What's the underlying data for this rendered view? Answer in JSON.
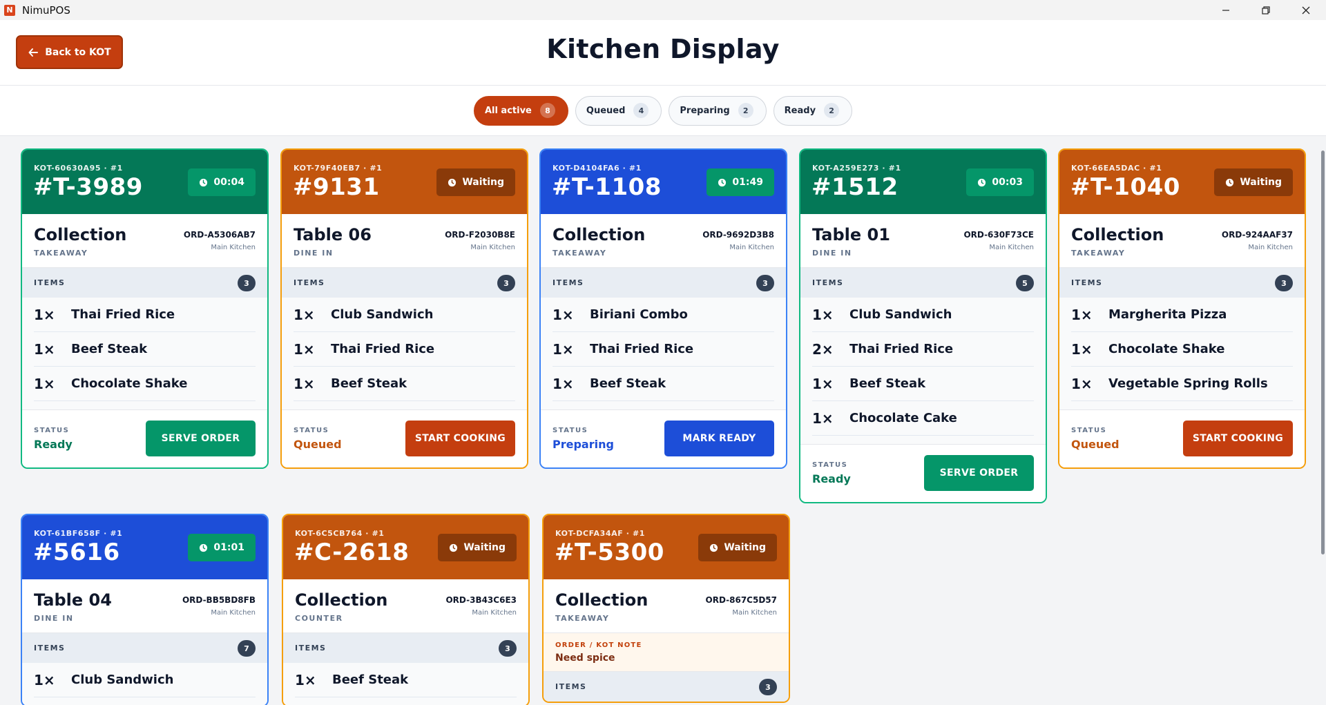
{
  "window": {
    "title": "NimuPOS",
    "logo_letter": "N"
  },
  "header": {
    "back_label": "Back to KOT",
    "title": "Kitchen Display"
  },
  "filters": [
    {
      "label": "All active",
      "count": "8"
    },
    {
      "label": "Queued",
      "count": "4"
    },
    {
      "label": "Preparing",
      "count": "2"
    },
    {
      "label": "Ready",
      "count": "2"
    }
  ],
  "labels": {
    "items": "ITEMS",
    "status": "STATUS",
    "note": "ORDER / KOT NOTE"
  },
  "colors": {
    "accent": "#c43e0f",
    "ready": "#047857",
    "queued": "#c2550e",
    "preparing": "#1d4ed8"
  },
  "cards": [
    {
      "kot": "KOT-60630A95 · #1",
      "ticket": "#T-3989",
      "timer": "00:04",
      "place": "Collection",
      "type": "TAKEAWAY",
      "order": "ORD-A5306AB7",
      "kitchen": "Main Kitchen",
      "item_count": "3",
      "items": [
        {
          "qty": "1×",
          "name": "Thai Fried Rice"
        },
        {
          "qty": "1×",
          "name": "Beef Steak"
        },
        {
          "qty": "1×",
          "name": "Chocolate Shake"
        }
      ],
      "status": "Ready",
      "action": "SERVE ORDER"
    },
    {
      "kot": "KOT-79F40EB7 · #1",
      "ticket": "#9131",
      "timer": "Waiting",
      "place": "Table 06",
      "type": "DINE IN",
      "order": "ORD-F2030B8E",
      "kitchen": "Main Kitchen",
      "item_count": "3",
      "items": [
        {
          "qty": "1×",
          "name": "Club Sandwich"
        },
        {
          "qty": "1×",
          "name": "Thai Fried Rice"
        },
        {
          "qty": "1×",
          "name": "Beef Steak"
        }
      ],
      "status": "Queued",
      "action": "START COOKING"
    },
    {
      "kot": "KOT-D4104FA6 · #1",
      "ticket": "#T-1108",
      "timer": "01:49",
      "place": "Collection",
      "type": "TAKEAWAY",
      "order": "ORD-9692D3B8",
      "kitchen": "Main Kitchen",
      "item_count": "3",
      "items": [
        {
          "qty": "1×",
          "name": "Biriani Combo"
        },
        {
          "qty": "1×",
          "name": "Thai Fried Rice"
        },
        {
          "qty": "1×",
          "name": "Beef Steak"
        }
      ],
      "status": "Preparing",
      "action": "MARK READY"
    },
    {
      "kot": "KOT-A259E273 · #1",
      "ticket": "#1512",
      "timer": "00:03",
      "place": "Table 01",
      "type": "DINE IN",
      "order": "ORD-630F73CE",
      "kitchen": "Main Kitchen",
      "item_count": "5",
      "items": [
        {
          "qty": "1×",
          "name": "Club Sandwich"
        },
        {
          "qty": "2×",
          "name": "Thai Fried Rice"
        },
        {
          "qty": "1×",
          "name": "Beef Steak"
        },
        {
          "qty": "1×",
          "name": "Chocolate Cake"
        }
      ],
      "status": "Ready",
      "action": "SERVE ORDER"
    },
    {
      "kot": "KOT-66EA5DAC · #1",
      "ticket": "#T-1040",
      "timer": "Waiting",
      "place": "Collection",
      "type": "TAKEAWAY",
      "order": "ORD-924AAF37",
      "kitchen": "Main Kitchen",
      "item_count": "3",
      "items": [
        {
          "qty": "1×",
          "name": "Margherita Pizza"
        },
        {
          "qty": "1×",
          "name": "Chocolate Shake"
        },
        {
          "qty": "1×",
          "name": "Vegetable Spring Rolls"
        }
      ],
      "status": "Queued",
      "action": "START COOKING"
    },
    {
      "kot": "KOT-61BF658F · #1",
      "ticket": "#5616",
      "timer": "01:01",
      "place": "Table 04",
      "type": "DINE IN",
      "order": "ORD-BB5BD8FB",
      "kitchen": "Main Kitchen",
      "item_count": "7",
      "items": [
        {
          "qty": "1×",
          "name": "Club Sandwich"
        }
      ]
    },
    {
      "kot": "KOT-6C5CB764 · #1",
      "ticket": "#C-2618",
      "timer": "Waiting",
      "place": "Collection",
      "type": "COUNTER",
      "order": "ORD-3B43C6E3",
      "kitchen": "Main Kitchen",
      "item_count": "3",
      "items": [
        {
          "qty": "1×",
          "name": "Beef Steak"
        }
      ]
    },
    {
      "kot": "KOT-DCFA34AF · #1",
      "ticket": "#T-5300",
      "timer": "Waiting",
      "place": "Collection",
      "type": "TAKEAWAY",
      "order": "ORD-867C5D57",
      "kitchen": "Main Kitchen",
      "item_count": "3",
      "note": "Need spice"
    }
  ]
}
